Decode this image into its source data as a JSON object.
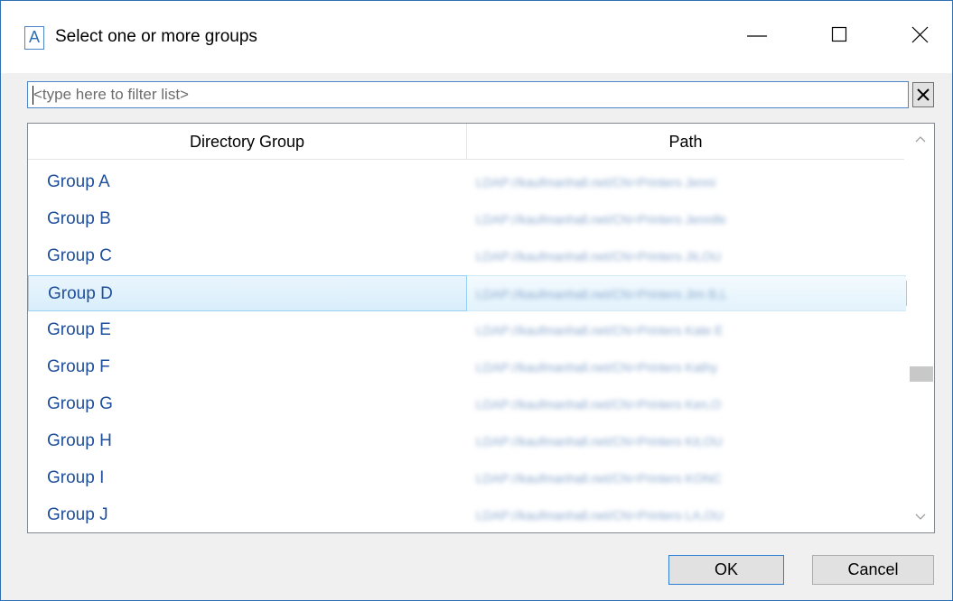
{
  "window": {
    "title": "Select one or more groups",
    "app_icon_letter": "A",
    "controls": [
      "minimize-icon",
      "maximize-icon",
      "close-icon"
    ]
  },
  "filter": {
    "placeholder": "<type here to filter list>",
    "value": "",
    "clear_icon": "close-icon"
  },
  "list": {
    "columns": [
      "Directory Group",
      "Path"
    ],
    "selected_index": 3,
    "rows": [
      {
        "name": "Group A",
        "path": "LDAP://kaufmanhall.net/CN=Printers Jenni"
      },
      {
        "name": "Group B",
        "path": "LDAP://kaufmanhall.net/CN=Printers Jennife"
      },
      {
        "name": "Group C",
        "path": "LDAP://kaufmanhall.net/CN=Printers JILOU"
      },
      {
        "name": "Group D",
        "path": "LDAP://kaufmanhall.net/CN=Printers Jim B,L"
      },
      {
        "name": "Group E",
        "path": "LDAP://kaufmanhall.net/CN=Printers Kate E"
      },
      {
        "name": "Group F",
        "path": "LDAP://kaufmanhall.net/CN=Printers Kathy"
      },
      {
        "name": "Group G",
        "path": "LDAP://kaufmanhall.net/CN=Printers Ken,O"
      },
      {
        "name": "Group H",
        "path": "LDAP://kaufmanhall.net/CN=Printers Kit,OU"
      },
      {
        "name": "Group I",
        "path": "LDAP://kaufmanhall.net/CN=Printers KONC"
      },
      {
        "name": "Group J",
        "path": "LDAP://kaufmanhall.net/CN=Printers LA,OU"
      }
    ]
  },
  "buttons": {
    "ok": "OK",
    "cancel": "Cancel"
  },
  "colors": {
    "accent": "#2f6fb4",
    "row_text": "#1f4f9a",
    "selection": "#d8eefb"
  }
}
